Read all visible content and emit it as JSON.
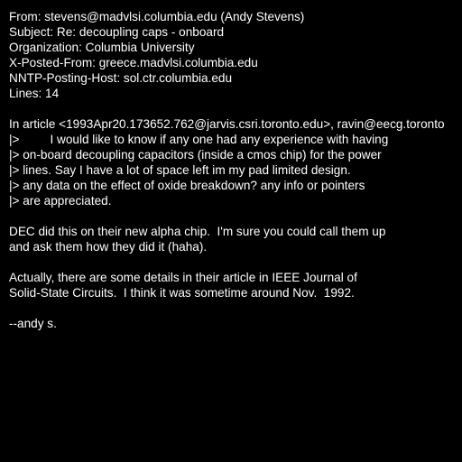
{
  "header": {
    "from": "From: stevens@madvlsi.columbia.edu (Andy Stevens)",
    "subject": "Subject: Re: decoupling caps - onboard",
    "organization": "Organization: Columbia University",
    "x_posted_from": "X-Posted-From: greece.madvlsi.columbia.edu",
    "nntp_posting_host": "NNTP-Posting-Host: sol.ctr.columbia.edu",
    "lines": "Lines: 14"
  },
  "body": {
    "attribution": "In article <1993Apr20.173652.762@jarvis.csri.toronto.edu>, ravin@eecg.toronto",
    "quoted": [
      "|>         I would like to know if any one had any experience with having",
      "|> on-board decoupling capacitors (inside a cmos chip) for the power",
      "|> lines. Say I have a lot of space left im my pad limited design.",
      "|> any data on the effect of oxide breakdown? any info or pointers",
      "|> are appreciated."
    ],
    "paragraph1": [
      "DEC did this on their new alpha chip.  I'm sure you could call them up",
      "and ask them how they did it (haha)."
    ],
    "paragraph2": [
      "Actually, there are some details in their article in IEEE Journal of",
      "Solid-State Circuits.  I think it was sometime around Nov.  1992."
    ],
    "signature": "--andy s."
  },
  "colors": {
    "background": "#000000",
    "text": "#ffffff"
  }
}
